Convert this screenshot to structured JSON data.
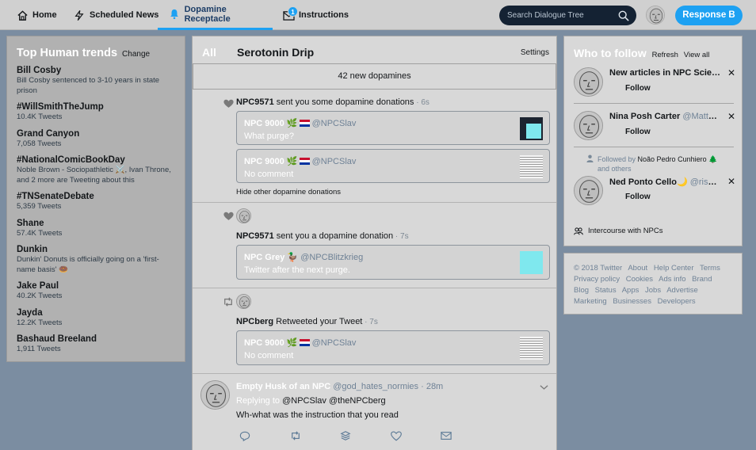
{
  "topbar": {
    "nav": [
      {
        "label": "Home",
        "icon": "home-icon"
      },
      {
        "label": "Scheduled News",
        "icon": "lightning-icon"
      },
      {
        "label": "Dopamine Receptacle",
        "icon": "bell-icon",
        "active": true
      },
      {
        "label": "Instructions",
        "icon": "envelope-icon",
        "badge": "1"
      }
    ],
    "search_placeholder": "Search Dialogue Tree",
    "response_button": "Response B"
  },
  "trends": {
    "title": "Top Human trends",
    "change": "Change",
    "items": [
      {
        "name": "Bill Cosby",
        "sub": "Bill Cosby sentenced to 3-10 years in state prison"
      },
      {
        "name": "#WillSmithTheJump",
        "sub": "10.4K Tweets"
      },
      {
        "name": "Grand Canyon",
        "sub": "7,058 Tweets"
      },
      {
        "name": "#NationalComicBookDay",
        "sub": "Noble Brown - Sociopathletic ⚔️, Ivan Throne, and 2 more are Tweeting about this"
      },
      {
        "name": "#TNSenateDebate",
        "sub": "5,359 Tweets"
      },
      {
        "name": "Shane",
        "sub": "57.4K Tweets"
      },
      {
        "name": "Dunkin",
        "sub": "Dunkin' Donuts is officially going on a 'first-name basis' 🍩"
      },
      {
        "name": "Jake Paul",
        "sub": "40.2K Tweets"
      },
      {
        "name": "Jayda",
        "sub": "12.2K Tweets"
      },
      {
        "name": "Bashaud Breeland",
        "sub": "1,911 Tweets"
      }
    ]
  },
  "feed": {
    "tab_all": "All",
    "title": "Serotonin Drip",
    "settings": "Settings",
    "new_bar": "42 new dopamines",
    "n1": {
      "actor": "NPC9571",
      "action": " sent you some dopamine donations",
      "ago": " · 6s",
      "card1": {
        "name": "NPC 9000",
        "handle": "@NPCSlav",
        "body": "What purge?"
      },
      "card2": {
        "name": "NPC 9000",
        "handle": "@NPCSlav",
        "body": "No comment"
      },
      "hide": "Hide other dopamine donations"
    },
    "n2": {
      "actor": "NPC9571",
      "action": " sent you a dopamine donation",
      "ago": " · 7s",
      "card": {
        "name": "NPC Grey",
        "handle": "@NPCBlitzkrieg",
        "body": "Twitter after the next purge."
      }
    },
    "n3": {
      "actor": "NPCberg",
      "action": " Retweeted your Tweet",
      "ago": " · 7s",
      "card": {
        "name": "NPC 9000",
        "handle": "@NPCSlav",
        "body": "No comment"
      }
    },
    "tweet": {
      "name": "Empty Husk of an NPC",
      "handle": "@god_hates_normies",
      "ago": " · 28m",
      "replying": "Replying to ",
      "replying_to": "@NPCSlav @theNPCberg",
      "text": "Wh-what was the instruction that you read"
    }
  },
  "follow": {
    "title": "Who to follow",
    "refresh": "Refresh",
    "view_all": "View all",
    "people": [
      {
        "name": "New articles in NPC Science",
        "handle": "",
        "button": "Follow"
      },
      {
        "name": "Nina Posh Carter",
        "handle": "@Matt_Herren",
        "button": "Follow"
      },
      {
        "name": "Ned Ponto Cello",
        "handle": "@riseoftheNPC",
        "button": "Follow"
      }
    ],
    "followed_by_prefix": "Followed by ",
    "followed_by_name": "Noão Pedro Cunhiero 🌲",
    "followed_by_suffix": "and others",
    "intercourse": "Intercourse with NPCs"
  },
  "footer": {
    "links": [
      "© 2018 Twitter",
      "About",
      "Help Center",
      "Terms",
      "Privacy policy",
      "Cookies",
      "Ads info",
      "Brand",
      "Blog",
      "Status",
      "Apps",
      "Jobs",
      "Advertise",
      "Marketing",
      "Businesses",
      "Developers"
    ]
  },
  "colors": {
    "accent": "#1da1f2",
    "background": "#7b8da1",
    "panel": "#d8d8d8",
    "search_bg": "#142233"
  }
}
